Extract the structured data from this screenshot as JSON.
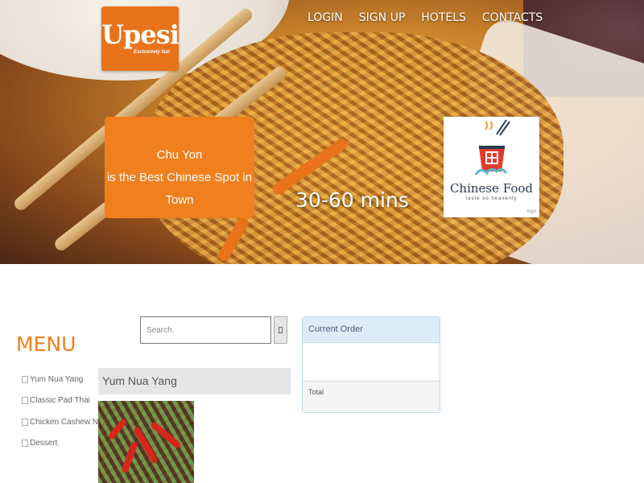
{
  "brand": {
    "name": "Upesi",
    "tagline": "Exclusively fast",
    "color": "#e8731a"
  },
  "nav": {
    "items": [
      "LOGIN",
      "SIGN UP",
      "HOTELS",
      "CONTACTS"
    ]
  },
  "hero": {
    "promo_line1": "Chu Yon",
    "promo_line2": "is the Best Chinese Spot in",
    "promo_line3": "Town",
    "delivery_time": "30-60 mins",
    "restaurant_logo_name": "Chinese Food",
    "restaurant_logo_tagline": "taste so heavenly",
    "restaurant_logo_mark": "logo"
  },
  "menu": {
    "title": "MENU",
    "items": [
      {
        "label": "Yum Nua Yang",
        "icon": "item-icon"
      },
      {
        "label": "Classic Pad Thai",
        "icon": "item-icon"
      },
      {
        "label": "Chicken Cashew Nuts",
        "icon": "item-icon"
      },
      {
        "label": "Dessert",
        "icon": "item-icon"
      }
    ]
  },
  "search": {
    "placeholder": "Search.",
    "button_icon": "search-icon"
  },
  "dish": {
    "title": "Yum Nua Yang"
  },
  "order": {
    "header": "Current Order",
    "total_label": "Total"
  },
  "colors": {
    "accent": "#f07f1e",
    "panel_header": "#dcedf7"
  }
}
